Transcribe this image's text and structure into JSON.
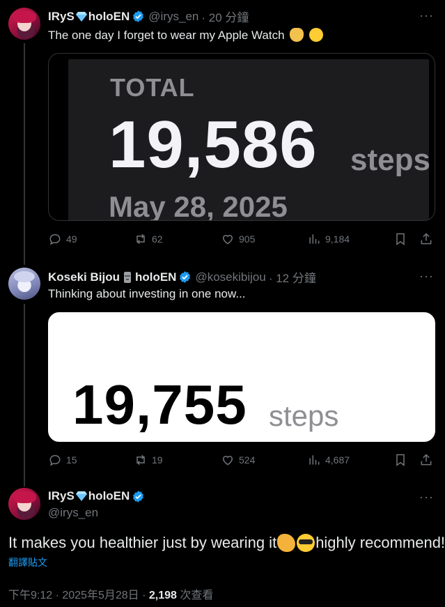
{
  "tweet1": {
    "name": "IRyS",
    "name_suffix": "holoEN",
    "handle": "@irys_en",
    "time": "· 20 分鐘",
    "text": "The one day I forget to wear my Apple Watch",
    "media": {
      "label": "TOTAL",
      "steps": "19,586",
      "unit": "steps",
      "date": "May 28, 2025"
    },
    "replies": "49",
    "reposts": "62",
    "likes": "905",
    "views": "9,184"
  },
  "tweet2": {
    "name": "Koseki Bijou",
    "name_suffix": "holoEN",
    "handle": "@kosekibijou",
    "time": "· 12 分鐘",
    "text": "Thinking about investing in one now...",
    "media": {
      "steps": "19,755",
      "unit": "steps"
    },
    "replies": "15",
    "reposts": "19",
    "likes": "524",
    "views": "4,687"
  },
  "main": {
    "name": "IRyS",
    "name_suffix": "holoEN",
    "handle": "@irys_en",
    "text_a": "It makes you healthier just by wearing it",
    "text_b": "highly recommend!",
    "translate": "翻譯貼文",
    "meta_time": "下午9:12 · 2025年5月28日 · ",
    "views": "2,198",
    "views_label": " 次查看"
  },
  "more_label": "···",
  "colors": {
    "verified": "#1d9bf0",
    "muted": "#71767b",
    "text": "#e7e9ea",
    "link": "#1d9bf0"
  },
  "icons": [
    "reply-icon",
    "repost-icon",
    "like-icon",
    "views-icon",
    "bookmark-icon",
    "share-icon",
    "verified-icon",
    "gem-icon",
    "more-icon"
  ]
}
